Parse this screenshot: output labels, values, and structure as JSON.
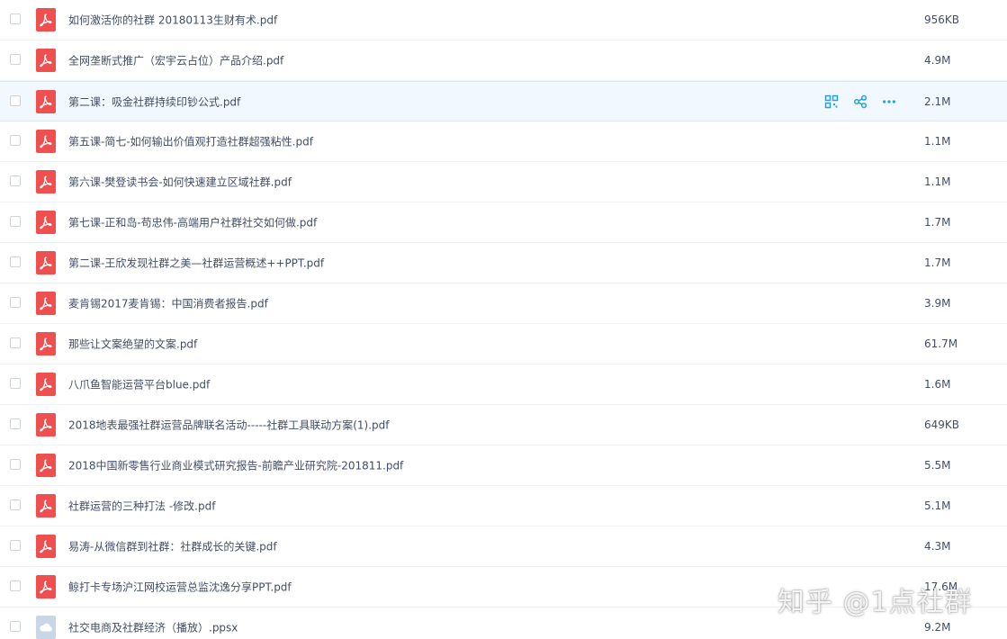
{
  "files": [
    {
      "name": "如何激活你的社群 20180113生财有术.pdf",
      "size": "956KB",
      "type": "pdf",
      "icon": "pdf-file-icon"
    },
    {
      "name": "全网垄断式推广（宏宇云占位）产品介绍.pdf",
      "size": "4.9M",
      "type": "pdf",
      "icon": "pdf-file-icon"
    },
    {
      "name": "第二课：吸金社群持续印钞公式.pdf",
      "size": "2.1M",
      "type": "pdf",
      "icon": "pdf-file-icon"
    },
    {
      "name": "第五课-简七-如何输出价值观打造社群超强粘性.pdf",
      "size": "1.1M",
      "type": "pdf",
      "icon": "pdf-file-icon"
    },
    {
      "name": "第六课-樊登读书会-如何快速建立区域社群.pdf",
      "size": "1.1M",
      "type": "pdf",
      "icon": "pdf-file-icon"
    },
    {
      "name": "第七课-正和岛-苟忠伟-高端用户社群社交如何做.pdf",
      "size": "1.7M",
      "type": "pdf",
      "icon": "pdf-file-icon"
    },
    {
      "name": "第二课-王欣发现社群之美—社群运营概述++PPT.pdf",
      "size": "1.7M",
      "type": "pdf",
      "icon": "pdf-file-icon"
    },
    {
      "name": "麦肯锡2017麦肯锡：中国消费者报告.pdf",
      "size": "3.9M",
      "type": "pdf",
      "icon": "pdf-file-icon"
    },
    {
      "name": "那些让文案绝望的文案.pdf",
      "size": "61.7M",
      "type": "pdf",
      "icon": "pdf-file-icon"
    },
    {
      "name": "八爪鱼智能运营平台blue.pdf",
      "size": "1.6M",
      "type": "pdf",
      "icon": "pdf-file-icon"
    },
    {
      "name": "2018地表最强社群运营品牌联名活动-----社群工具联动方案(1).pdf",
      "size": "649KB",
      "type": "pdf",
      "icon": "pdf-file-icon"
    },
    {
      "name": "2018中国新零售行业商业模式研究报告-前瞻产业研究院-201811.pdf",
      "size": "5.5M",
      "type": "pdf",
      "icon": "pdf-file-icon"
    },
    {
      "name": "社群运营的三种打法 -修改.pdf",
      "size": "5.1M",
      "type": "pdf",
      "icon": "pdf-file-icon"
    },
    {
      "name": "易涛-从微信群到社群：社群成长的关键.pdf",
      "size": "4.3M",
      "type": "pdf",
      "icon": "pdf-file-icon"
    },
    {
      "name": "鲸打卡专场沪江网校运营总监沈逸分享PPT.pdf",
      "size": "17.6M",
      "type": "pdf",
      "icon": "pdf-file-icon"
    },
    {
      "name": "社交电商及社群经济（播放）.ppsx",
      "size": "9.2M",
      "type": "cloud",
      "icon": "cloud-file-icon"
    }
  ],
  "hovered_index": 2,
  "watermark": "知乎 @1点社群",
  "colors": {
    "pdf_icon": "#ef4f4f",
    "accent": "#1fa3dc",
    "text": "#424e67",
    "hover_bg": "#f2f8ff"
  }
}
